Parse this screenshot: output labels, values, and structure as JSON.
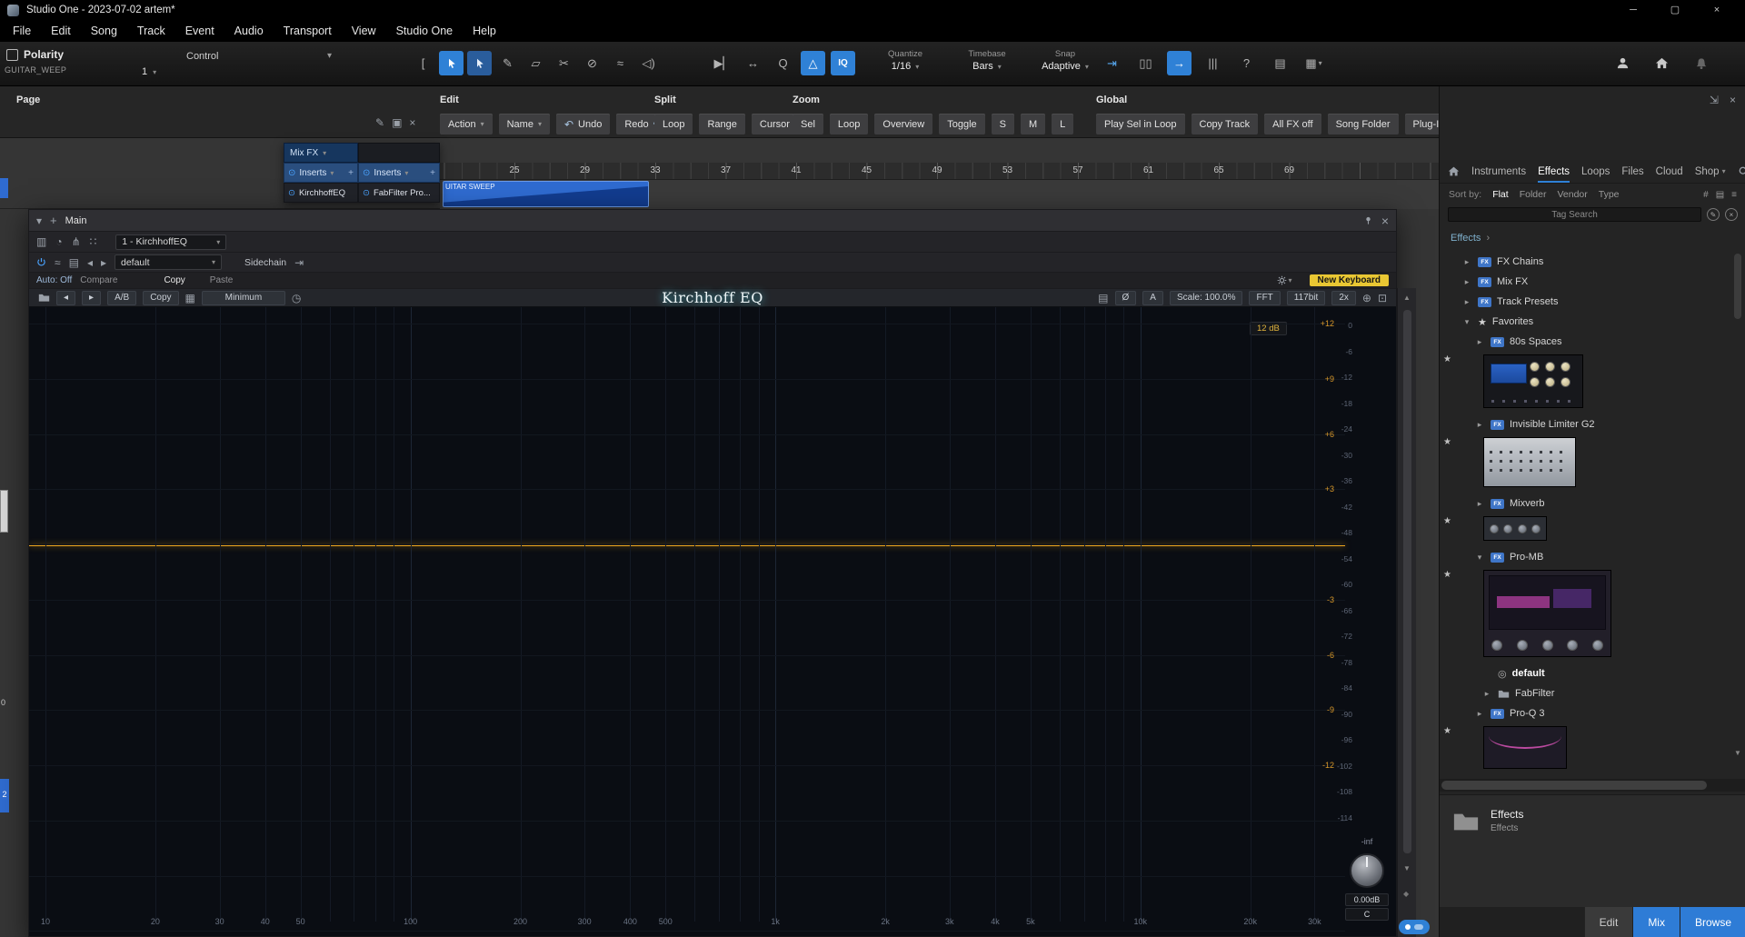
{
  "colors": {
    "accent_blue": "#2f81d6",
    "eq_line_orange": "#f2a71b",
    "badge_yellow": "#e9c733"
  },
  "icons": {
    "caret_down": "▾",
    "caret_right": "▸",
    "caret_up": "▴",
    "plus": "+",
    "close": "×",
    "prev": "◂",
    "next": "▸",
    "piano": "▦",
    "clock": "◷",
    "list": "▤",
    "globe": "⊕",
    "expand": "⊡",
    "route": "⇥",
    "scroll_up": "▲",
    "scroll_down": "▼",
    "diamond": "◆",
    "chevron": "›",
    "layout": "▥",
    "history": "◔",
    "branch": "⋔",
    "dots": "∷",
    "curve": "≈",
    "star": "★",
    "preset": "◎",
    "sort_filter": "#",
    "sort_panel": "▤",
    "sort_list": "≡",
    "edit_circle": "✎",
    "clear_circle": "×"
  },
  "titlebar": {
    "title": "Studio One - 2023-07-02 artem*",
    "window_controls": [
      {
        "name": "minimize-button",
        "glyph": "─"
      },
      {
        "name": "maximize-button",
        "glyph": "▢"
      },
      {
        "name": "close-button",
        "glyph": "×"
      }
    ]
  },
  "menubar": {
    "items": [
      "File",
      "Edit",
      "Song",
      "Track",
      "Event",
      "Audio",
      "Transport",
      "View",
      "Studio One",
      "Help"
    ]
  },
  "toolbar": {
    "polarity_label": "Polarity",
    "polarity_sub": "GUITAR_WEEP",
    "control_label": "Control",
    "control_value": "1",
    "tools": [
      {
        "name": "range-tool",
        "glyph": "["
      },
      {
        "name": "arrow-tool",
        "icon": "cursor",
        "active": true
      },
      {
        "name": "smart-range-tool",
        "icon": "cursor",
        "semi": true
      },
      {
        "name": "paint-tool",
        "glyph": "✎"
      },
      {
        "name": "eraser-tool",
        "glyph": "▱"
      },
      {
        "name": "split-tool",
        "glyph": "✂"
      },
      {
        "name": "mute-tool",
        "glyph": "⊘"
      },
      {
        "name": "bend-tool",
        "glyph": "≈"
      },
      {
        "name": "listen-tool",
        "glyph": "◁)"
      }
    ],
    "mode_icons": [
      {
        "name": "autoscroll-icon",
        "glyph": "▶▏"
      },
      {
        "name": "track-resize-icon",
        "glyph": "↔"
      },
      {
        "name": "quantize-q-icon",
        "glyph": "Q"
      },
      {
        "name": "metronome-icon",
        "glyph": "△",
        "active": true
      },
      {
        "name": "input-quantize-icon",
        "glyph": "IQ",
        "active": true
      }
    ],
    "quantize": {
      "label": "Quantize",
      "value": "1/16"
    },
    "timebase": {
      "label": "Timebase",
      "value": "Bars"
    },
    "snap": {
      "label": "Snap",
      "value": "Adaptive"
    },
    "system_icons": [
      {
        "name": "snap-cursor-icon",
        "glyph": "⇥",
        "blue": true
      },
      {
        "name": "dual-view-icon",
        "glyph": "▯▯"
      },
      {
        "name": "follow-playhead-icon",
        "glyph": "→",
        "active": true
      },
      {
        "name": "mixer-view-icon",
        "glyph": "|||"
      },
      {
        "name": "help-icon",
        "glyph": "?"
      },
      {
        "name": "video-track-icon",
        "glyph": "▤"
      },
      {
        "name": "macro-grid-icon",
        "glyph": "▦",
        "arrow": true
      }
    ],
    "account_icons": [
      {
        "name": "user-account-icon",
        "icon": "person"
      },
      {
        "name": "home-icon",
        "icon": "home"
      },
      {
        "name": "notifications-icon",
        "icon": "bell",
        "dim": true
      }
    ]
  },
  "ribbon": {
    "page_label": "Page",
    "popup_icons": [
      {
        "name": "draw-icon",
        "glyph": "✎"
      },
      {
        "name": "panel-icon",
        "glyph": "▣"
      },
      {
        "name": "close-icon",
        "glyph": "×"
      }
    ],
    "groups": [
      {
        "label": "Edit",
        "buttons": [
          {
            "label": "Action",
            "arrow": true
          },
          {
            "label": "Name",
            "arrow": true
          },
          {
            "label": "Undo",
            "pre": "↶"
          },
          {
            "label": "Redo",
            "post": "↷"
          }
        ]
      },
      {
        "label": "Split",
        "buttons": [
          {
            "label": "Loop"
          },
          {
            "label": "Range"
          },
          {
            "label": "Cursor"
          }
        ]
      },
      {
        "label": "Zoom",
        "buttons": [
          {
            "label": "Sel"
          },
          {
            "label": "Loop"
          },
          {
            "label": "Overview"
          },
          {
            "label": "Toggle"
          },
          {
            "label": "S"
          },
          {
            "label": "M"
          },
          {
            "label": "L"
          }
        ]
      },
      {
        "label": "Global",
        "buttons": [
          {
            "label": "Play Sel in Loop"
          },
          {
            "label": "Copy Track"
          },
          {
            "label": "All FX off"
          },
          {
            "label": "Song Folder"
          },
          {
            "label": "Plug-In Manager"
          }
        ]
      }
    ],
    "corner_icons": [
      {
        "name": "dock-panel-icon",
        "glyph": "⇲"
      },
      {
        "name": "close-panel-icon",
        "glyph": "×"
      }
    ]
  },
  "arrange": {
    "timeline_numbers": [
      25,
      29,
      33,
      37,
      41,
      45,
      49,
      53,
      57,
      61,
      65,
      69
    ],
    "region_label": "UITAR SWEEP",
    "left_edge_labels": [
      "0",
      "2"
    ]
  },
  "mixfx": {
    "title": "Mix FX",
    "channels": [
      {
        "inserts_label": "Inserts",
        "plugin": "KirchhoffEQ"
      },
      {
        "inserts_label": "Inserts",
        "plugin": "FabFilter Pro..."
      }
    ]
  },
  "plugin_window": {
    "title": "Main",
    "channel_selector": "1 - KirchhoffEQ",
    "preset_selector": "default",
    "sidechain_label": "Sidechain",
    "auto_label": "Auto: Off",
    "compare_label": "Compare",
    "copy_label": "Copy",
    "paste_label": "Paste",
    "new_keyboard_label": "New Keyboard",
    "slot_icons": [
      {
        "name": "layout-grid-icon",
        "glyph": "▥"
      },
      {
        "name": "history-icon",
        "glyph": "◔"
      },
      {
        "name": "split-view-icon",
        "glyph": "⋔"
      },
      {
        "name": "grid-dots-icon",
        "glyph": "∷"
      }
    ]
  },
  "eq": {
    "toolbar": {
      "ab_label": "A/B",
      "copy_label": "Copy",
      "phase_mode_label": "Minimum",
      "title": "Kirchhoff EQ",
      "phase_invert_label": "Ø",
      "channel_label": "A",
      "scale_label": "Scale: 100.0%",
      "fft_label": "FFT",
      "bit_label": "117bit",
      "oversampling_label": "2x"
    },
    "display": {
      "range_badge": "12 dB",
      "gain_scale": [
        "+12",
        "+9",
        "+6",
        "+3",
        "-3",
        "-6",
        "-9",
        "-12"
      ],
      "spectrum_scale": [
        "0",
        "-6",
        "-12",
        "-18",
        "-24",
        "-30",
        "-36",
        "-42",
        "-48",
        "-54",
        "-60",
        "-66",
        "-72",
        "-78",
        "-84",
        "-90",
        "-96",
        "-102",
        "-108",
        "-114"
      ],
      "freq_labels": [
        {
          "f": 10,
          "label": "10"
        },
        {
          "f": 20,
          "label": "20"
        },
        {
          "f": 30,
          "label": "30"
        },
        {
          "f": 40,
          "label": "40"
        },
        {
          "f": 50,
          "label": "50"
        },
        {
          "f": 100,
          "label": "100"
        },
        {
          "f": 200,
          "label": "200"
        },
        {
          "f": 300,
          "label": "300"
        },
        {
          "f": 400,
          "label": "400"
        },
        {
          "f": 500,
          "label": "500"
        },
        {
          "f": 1000,
          "label": "1k"
        },
        {
          "f": 2000,
          "label": "2k"
        },
        {
          "f": 3000,
          "label": "3k"
        },
        {
          "f": 4000,
          "label": "4k"
        },
        {
          "f": 5000,
          "label": "5k"
        },
        {
          "f": 10000,
          "label": "10k"
        },
        {
          "f": 20000,
          "label": "20k"
        },
        {
          "f": 30000,
          "label": "30k"
        }
      ],
      "output": {
        "meter_label": "-inf",
        "gain_value": "0.00dB",
        "pan_value": "C"
      }
    }
  },
  "browser": {
    "tabs": [
      {
        "label": "Instruments"
      },
      {
        "label": "Effects",
        "active": true
      },
      {
        "label": "Loops"
      },
      {
        "label": "Files"
      },
      {
        "label": "Cloud"
      },
      {
        "label": "Shop",
        "arrow": true
      }
    ],
    "sort_label": "Sort by:",
    "sort_options": [
      {
        "label": "Flat",
        "active": true
      },
      {
        "label": "Folder"
      },
      {
        "label": "Vendor"
      },
      {
        "label": "Type"
      }
    ],
    "search_placeholder": "Tag Search",
    "breadcrumb": "Effects",
    "tree": [
      {
        "label": "FX Chains",
        "icon": "fx",
        "arrow": "collapsed",
        "level": 0
      },
      {
        "label": "Mix FX",
        "icon": "fx",
        "arrow": "collapsed",
        "level": 0
      },
      {
        "label": "Track Presets",
        "icon": "fx",
        "arrow": "collapsed",
        "level": 0
      },
      {
        "label": "Favorites",
        "icon": "star",
        "arrow": "expanded",
        "level": 0
      },
      {
        "label": "80s Spaces",
        "icon": "fx",
        "arrow": "collapsed",
        "level": 1,
        "thumb": "spaces80",
        "starred": true
      },
      {
        "label": "Invisible Limiter G2",
        "icon": "fx",
        "arrow": "collapsed",
        "level": 1,
        "thumb": "limiter",
        "starred": true
      },
      {
        "label": "Mixverb",
        "icon": "fx",
        "arrow": "collapsed",
        "level": 1,
        "thumb": "mixverb",
        "starred": true
      },
      {
        "label": "Pro-MB",
        "icon": "fx",
        "arrow": "expanded",
        "level": 1,
        "thumb": "promb",
        "starred": true
      },
      {
        "label": "default",
        "icon": "preset",
        "level": 2,
        "bold": true
      },
      {
        "label": "FabFilter",
        "icon": "folder",
        "arrow": "collapsed",
        "level": 2
      },
      {
        "label": "Pro-Q 3",
        "icon": "fx",
        "arrow": "collapsed",
        "level": 1,
        "thumb": "proq3",
        "starred": true
      }
    ],
    "info": {
      "title": "Effects",
      "subtitle": "Effects"
    },
    "bottom_tabs": [
      {
        "label": "Edit"
      },
      {
        "label": "Mix",
        "style": "blue"
      },
      {
        "label": "Browse",
        "style": "blue"
      }
    ]
  }
}
